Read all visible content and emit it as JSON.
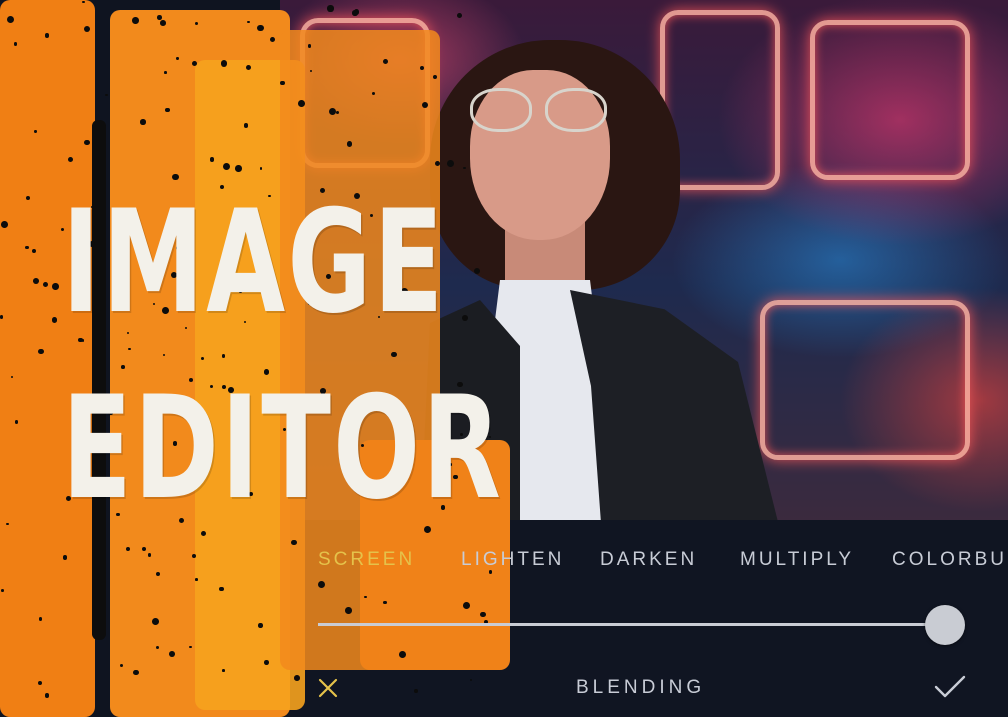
{
  "banner": {
    "title_line1": "IMAGE",
    "title_line2": "EDITOR"
  },
  "blend_modes": {
    "selected": "SCREEN",
    "items": [
      "SCREEN",
      "LIGHTEN",
      "DARKEN",
      "MULTIPLY",
      "COLORBU"
    ]
  },
  "slider": {
    "value": 1.0
  },
  "bottom_bar": {
    "title": "BLENDING",
    "cancel_icon": "close-icon",
    "confirm_icon": "check-icon"
  },
  "colors": {
    "accent": "#e5c24a",
    "brush_orange": "#f28a1c",
    "brush_yellow": "#f5a623",
    "toolbar_bg": "#101522",
    "text_light": "#c8ccd6"
  }
}
